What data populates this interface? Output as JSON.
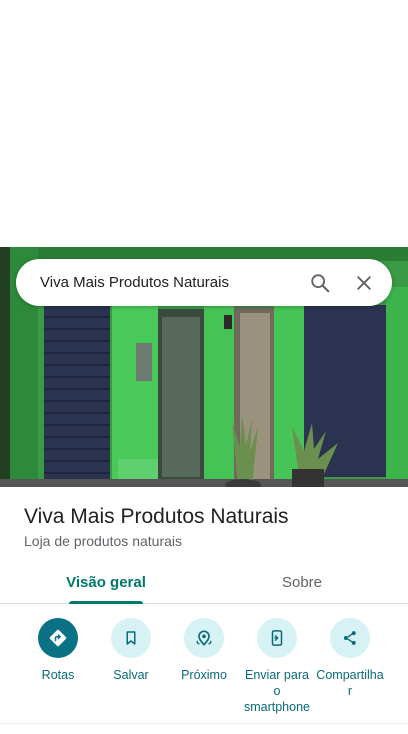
{
  "search": {
    "query": "Viva Mais Produtos Naturais"
  },
  "place": {
    "name": "Viva Mais Produtos Naturais",
    "category": "Loja de produtos naturais"
  },
  "tabs": [
    {
      "label": "Visão geral",
      "active": true
    },
    {
      "label": "Sobre",
      "active": false
    }
  ],
  "actions": [
    {
      "label": "Rotas",
      "icon": "directions-icon"
    },
    {
      "label": "Salvar",
      "icon": "bookmark-icon"
    },
    {
      "label": "Próximo",
      "icon": "nearby-icon"
    },
    {
      "label": "Enviar para\no\nsmartphone",
      "icon": "send-to-phone-icon"
    },
    {
      "label": "Compartilha\nr",
      "icon": "share-icon"
    }
  ],
  "colors": {
    "accent": "#00796b",
    "action_primary": "#0b7285",
    "action_bg": "#d6f2f4",
    "storefront_green": "#3dbb4f"
  }
}
